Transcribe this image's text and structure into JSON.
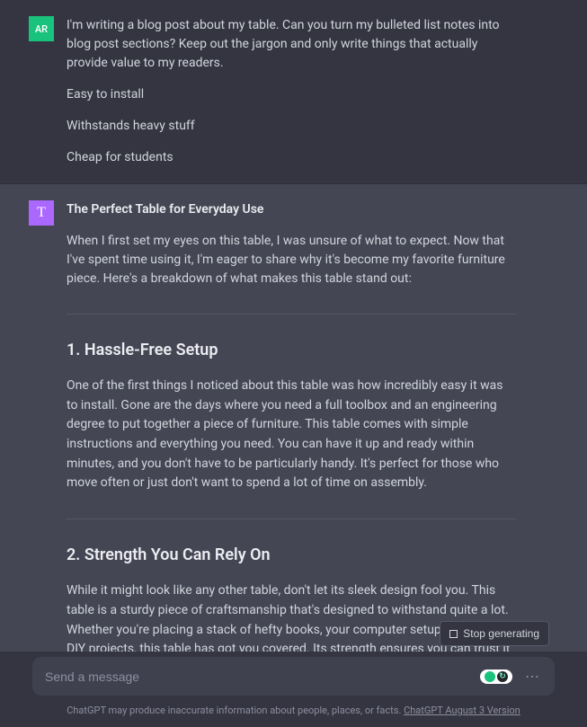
{
  "user_message": {
    "avatar_initials": "AR",
    "paragraphs": [
      "I'm writing a blog post about my table. Can you turn my bulleted list notes into blog post sections? Keep out the jargon and only write things that actually provide value to my readers.",
      "Easy to install",
      "Withstands heavy stuff",
      "Cheap for students"
    ]
  },
  "assistant_message": {
    "avatar_glyph": "T",
    "title": "The Perfect Table for Everyday Use",
    "intro": "When I first set my eyes on this table, I was unsure of what to expect. Now that I've spent time using it, I'm eager to share why it's become my favorite furniture piece. Here's a breakdown of what makes this table stand out:",
    "sections": [
      {
        "heading": "1. Hassle-Free Setup",
        "body": "One of the first things I noticed about this table was how incredibly easy it was to install. Gone are the days where you need a full toolbox and an engineering degree to put together a piece of furniture. This table comes with simple instructions and everything you need. You can have it up and ready within minutes, and you don't have to be particularly handy. It's perfect for those who move often or just don't want to spend a lot of time on assembly."
      },
      {
        "heading": "2. Strength You Can Rely On",
        "body": "While it might look like any other table, don't let its sleek design fool you. This table is a sturdy piece of craftsmanship that's designed to withstand quite a lot. Whether you're placing a stack of hefty books, your computer setup, or even your DIY projects, this table has got you covered. Its strength ensures you can trust it to"
      }
    ]
  },
  "controls": {
    "stop_label": "Stop generating"
  },
  "input": {
    "placeholder": "Send a message"
  },
  "footer": {
    "disclaimer": "ChatGPT may produce inaccurate information about people, places, or facts. ",
    "version_link": "ChatGPT August 3 Version"
  }
}
